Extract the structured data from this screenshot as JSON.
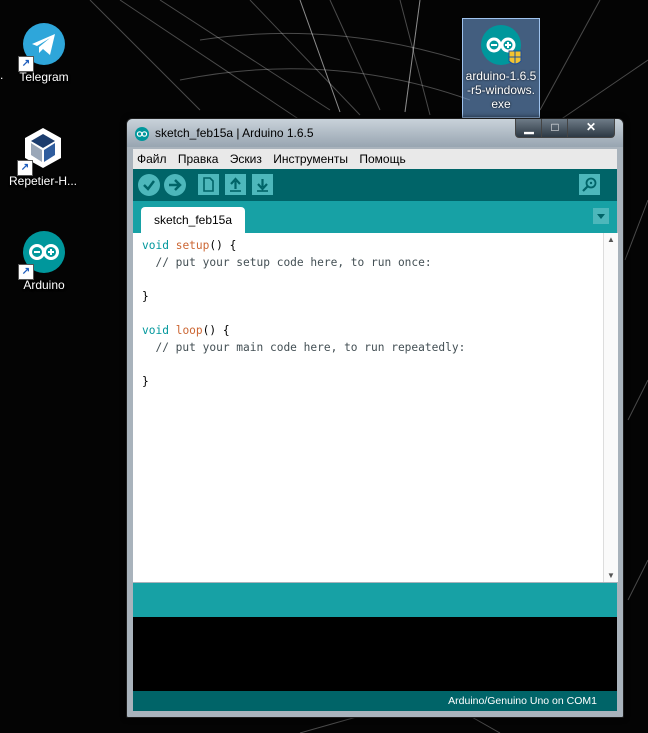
{
  "desktop": {
    "icons": [
      {
        "label": "Telegram"
      },
      {
        "label": "Repetier-H..."
      },
      {
        "label": "Arduino"
      }
    ],
    "installer": {
      "label_lines": [
        "arduino-1.6.5",
        "-r5-windows.",
        "exe"
      ]
    },
    "left_edge_char": "."
  },
  "window": {
    "title": "sketch_feb15a | Arduino 1.6.5",
    "controls": {
      "minimize": "▁",
      "maximize": "□",
      "close": "✕"
    }
  },
  "menu": [
    "Файл",
    "Правка",
    "Эскиз",
    "Инструменты",
    "Помощь"
  ],
  "toolbar": {
    "buttons": [
      {
        "name": "verify",
        "icon": "check-icon"
      },
      {
        "name": "upload",
        "icon": "arrow-right-icon"
      },
      {
        "name": "new",
        "icon": "file-icon"
      },
      {
        "name": "open",
        "icon": "arrow-up-icon"
      },
      {
        "name": "save",
        "icon": "arrow-down-icon"
      }
    ],
    "serial_monitor_icon": "magnifier-icon"
  },
  "tabs": [
    {
      "label": "sketch_feb15a"
    }
  ],
  "code": {
    "lines": [
      "void setup() {",
      "  // put your setup code here, to run once:",
      "",
      "}",
      "",
      "void loop() {",
      "  // put your main code here, to run repeatedly:",
      "",
      "}"
    ]
  },
  "status": {
    "board": "Arduino/Genuino Uno on COM1"
  },
  "colors": {
    "teal_dark": "#006468",
    "teal": "#17a1a5",
    "button": "#4db7bb"
  }
}
